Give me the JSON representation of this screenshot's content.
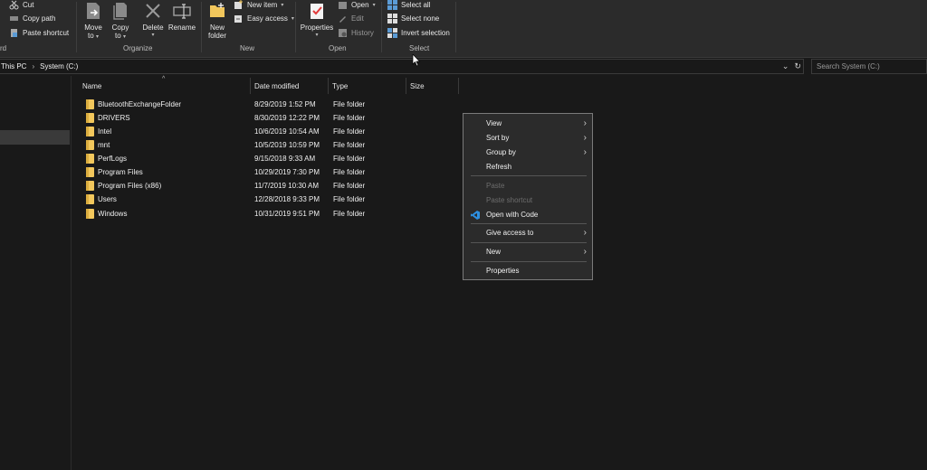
{
  "ribbon": {
    "clipboard": {
      "group_label": "rd",
      "cut": "Cut",
      "copy_path": "Copy path",
      "paste_shortcut": "Paste shortcut"
    },
    "organize": {
      "group_label": "Organize",
      "move_to": "Move",
      "move_to_2": "to",
      "copy_to": "Copy",
      "copy_to_2": "to",
      "delete": "Delete",
      "rename": "Rename"
    },
    "new": {
      "group_label": "New",
      "new_folder": "New",
      "new_folder_2": "folder",
      "new_item": "New item",
      "easy_access": "Easy access"
    },
    "open": {
      "group_label": "Open",
      "properties": "Properties",
      "open": "Open",
      "edit": "Edit",
      "history": "History"
    },
    "select": {
      "group_label": "Select",
      "select_all": "Select all",
      "select_none": "Select none",
      "invert_selection": "Invert selection"
    }
  },
  "address": {
    "crumbs": [
      "This PC",
      "System (C:)"
    ],
    "search_placeholder": "Search System (C:)"
  },
  "columns": {
    "name": "Name",
    "date_modified": "Date modified",
    "type": "Type",
    "size": "Size"
  },
  "files": [
    {
      "name": "BluetoothExchangeFolder",
      "date": "8/29/2019 1:52 PM",
      "type": "File folder"
    },
    {
      "name": "DRIVERS",
      "date": "8/30/2019 12:22 PM",
      "type": "File folder"
    },
    {
      "name": "Intel",
      "date": "10/6/2019 10:54 AM",
      "type": "File folder"
    },
    {
      "name": "mnt",
      "date": "10/5/2019 10:59 PM",
      "type": "File folder"
    },
    {
      "name": "PerfLogs",
      "date": "9/15/2018 9:33 AM",
      "type": "File folder"
    },
    {
      "name": "Program Files",
      "date": "10/29/2019 7:30 PM",
      "type": "File folder"
    },
    {
      "name": "Program Files (x86)",
      "date": "11/7/2019 10:30 AM",
      "type": "File folder"
    },
    {
      "name": "Users",
      "date": "12/28/2018 9:33 PM",
      "type": "File folder"
    },
    {
      "name": "Windows",
      "date": "10/31/2019 9:51 PM",
      "type": "File folder"
    }
  ],
  "context_menu": {
    "view": "View",
    "sort_by": "Sort by",
    "group_by": "Group by",
    "refresh": "Refresh",
    "paste": "Paste",
    "paste_shortcut": "Paste shortcut",
    "open_with_code": "Open with Code",
    "give_access_to": "Give access to",
    "new": "New",
    "properties": "Properties"
  },
  "colors": {
    "background": "#191919",
    "ribbon": "#2b2b2b",
    "folder": "#f2c75c",
    "vscode_blue": "#2d8fe0"
  }
}
